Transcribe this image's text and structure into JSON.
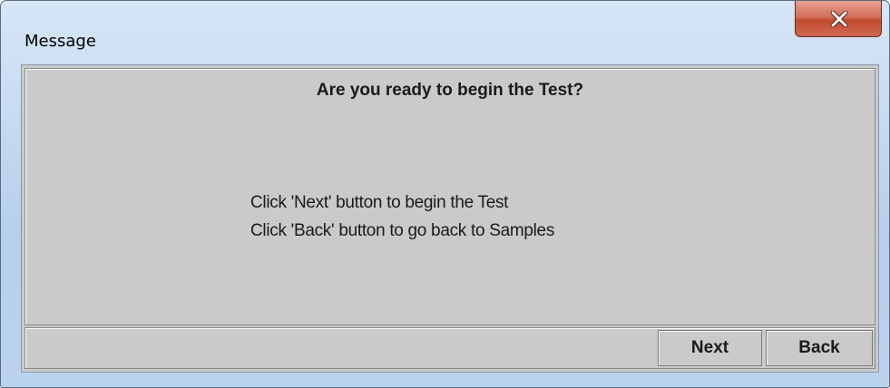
{
  "window": {
    "title": "Message",
    "close_icon": "close-x-icon"
  },
  "dialog": {
    "heading": "Are you ready to begin the Test?",
    "lines": [
      "Click 'Next' button to begin the Test",
      "Click 'Back' button to go back to Samples"
    ]
  },
  "buttons": {
    "next_label": "Next",
    "back_label": "Back"
  },
  "colors": {
    "panel_background": "#cacaca",
    "titlebar": "#c4d9f1",
    "close_button": "#c14a30"
  }
}
